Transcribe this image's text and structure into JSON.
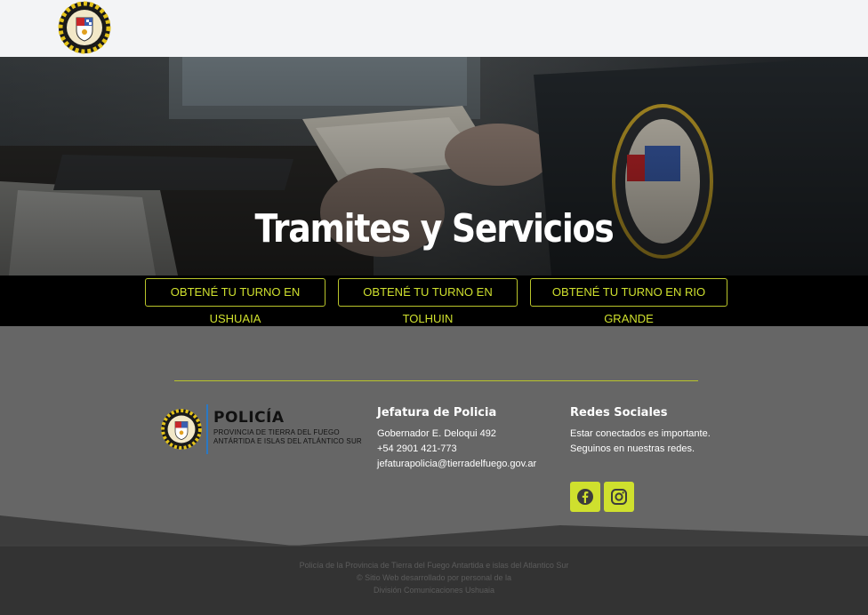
{
  "header": {
    "logo_name": "police-shield-logo"
  },
  "hero": {
    "title": "Tramites y Servicios"
  },
  "turnos": [
    {
      "label": "OBTENÉ TU TURNO EN USHUAIA"
    },
    {
      "label": "OBTENÉ TU TURNO EN TOLHUIN"
    },
    {
      "label": "OBTENÉ TU TURNO EN RIO GRANDE"
    }
  ],
  "footer": {
    "brand": {
      "word": "POLICÍA",
      "line1": "PROVINCIA DE TIERRA DEL FUEGO",
      "line2": "ANTÁRTIDA E ISLAS DEL ATLÁNTICO SUR"
    },
    "jefatura": {
      "title": "Jefatura de Policia",
      "address": "Gobernador E. Deloqui 492",
      "phone": "+54 2901 421-773",
      "email": "jefaturapolicia@tierradelfuego.gov.ar"
    },
    "redes": {
      "title": "Redes Sociales",
      "line1": "Estar conectados es importante.",
      "line2": "Seguinos en nuestras redes.",
      "icons": [
        "facebook-icon",
        "instagram-icon"
      ]
    },
    "credits": {
      "line1": "Policía de la Provincia de Tierra del Fuego Antartida e islas del Atlantico Sur",
      "line2": "© Sitio Web desarrollado por personal de la",
      "line3": "División Comunicaciones Ushuaia"
    }
  },
  "colors": {
    "accent": "#cfe02e",
    "footer_bg": "#666666",
    "band_bg": "#000000"
  }
}
